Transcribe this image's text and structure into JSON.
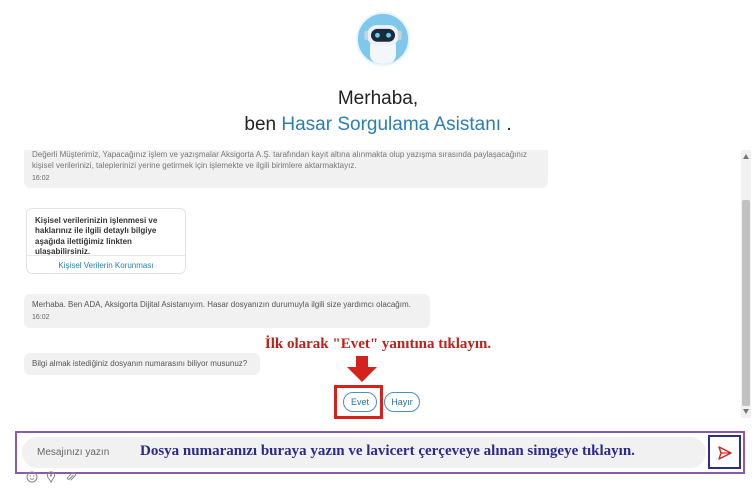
{
  "header": {
    "greeting": "Merhaba,",
    "subtitle_prefix": "ben ",
    "assistant_name": "Hasar Sorgulama Asistanı",
    "subtitle_suffix": " ."
  },
  "messages": [
    {
      "text": "Değerli Müşterimiz, Yapacağınız işlem ve yazışmalar Aksigorta A.Ş. tarafından kayıt altına alınmakta olup yazışma sırasında paylaşacağınız kişisel verilerinizi, taleplerinizi yerine getirmek için işlemekte ve ilgili birimlere aktarmaktayız.",
      "time": "16:02"
    },
    {
      "text": "Merhaba. Ben ADA, Aksigorta Dijital Asistanıyım. Hasar dosyanızın durumuyla ilgili size yardımcı olacağım.",
      "time": "16:02"
    },
    {
      "text": "Bilgi almak istediğiniz dosyanın numarasını biliyor musunuz?"
    }
  ],
  "card": {
    "text": "Kişisel verilerinizin işlenmesi ve haklarınız ile ilgili detaylı bilgiye aşağıda ilettiğimiz linkten ulaşabilirsiniz.",
    "link": "Kişisel Verilerin Korunması"
  },
  "quick_replies": {
    "yes": "Evet",
    "no": "Hayır"
  },
  "annotations": {
    "top": "İlk olarak \"Evet\" yanıtına tıklayın.",
    "bottom": "Dosya numaranızı buraya yazın ve lavicert çerçeveye alınan simgeye tıklayın."
  },
  "composer": {
    "placeholder": "Mesajınızı yazın"
  },
  "icons": {
    "avatar": "robot-avatar",
    "send": "send-icon",
    "arrow": "arrow-down-icon",
    "footer": [
      "emoji-icon",
      "location-icon",
      "attachment-icon"
    ]
  },
  "colors": {
    "accent": "#2a7fb0",
    "annotation_red": "#c0201a",
    "annotation_navy": "#2a2a8a",
    "frame_purple": "#8b59a8",
    "send_frame": "#2e2e86"
  }
}
